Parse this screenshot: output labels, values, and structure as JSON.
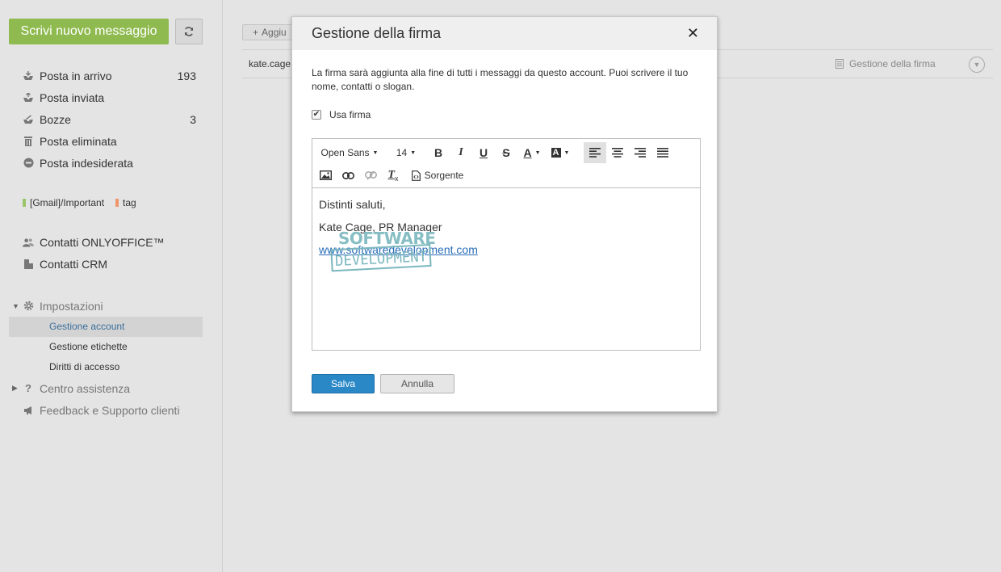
{
  "sidebar": {
    "compose_label": "Scrivi nuovo messaggio",
    "folders": [
      {
        "label": "Posta in arrivo",
        "count": "193"
      },
      {
        "label": "Posta inviata",
        "count": ""
      },
      {
        "label": "Bozze",
        "count": "3"
      },
      {
        "label": "Posta eliminata",
        "count": ""
      },
      {
        "label": "Posta indesiderata",
        "count": ""
      }
    ],
    "tags": [
      {
        "label": "[Gmail]/Important",
        "color": "#9cc46a"
      },
      {
        "label": "tag",
        "color": "#f0956a"
      }
    ],
    "contacts": [
      {
        "label": "Contatti ONLYOFFICE™"
      },
      {
        "label": "Contatti CRM"
      }
    ],
    "settings": {
      "label": "Impostazioni",
      "items": [
        {
          "label": "Gestione account"
        },
        {
          "label": "Gestione etichette"
        },
        {
          "label": "Diritti di accesso"
        }
      ]
    },
    "help_label": "Centro assistenza",
    "feedback_label": "Feedback e Supporto clienti"
  },
  "content": {
    "add_label": "Aggiu",
    "account_email": "kate.cage",
    "signature_link": "Gestione della firma"
  },
  "modal": {
    "title": "Gestione della firma",
    "description": "La firma sarà aggiunta alla fine di tutti i messaggi da questo account. Puoi scrivere il tuo nome, contatti o slogan.",
    "use_signature_label": "Usa firma",
    "use_signature_checked": true,
    "toolbar": {
      "font": "Open Sans",
      "size": "14",
      "source_label": "Sorgente"
    },
    "signature": {
      "line1": "Distinti saluti,",
      "line2": "Kate Cage, PR Manager",
      "link": "www.softwaredevelopment.com",
      "logo_top": "SOFTWARE",
      "logo_bottom": "DEVELOPMENT"
    },
    "save_label": "Salva",
    "cancel_label": "Annulla"
  },
  "colors": {
    "compose": "#8fba50",
    "save": "#2a88c7",
    "link": "#2a6db8",
    "logo": "#7bb7bf"
  }
}
